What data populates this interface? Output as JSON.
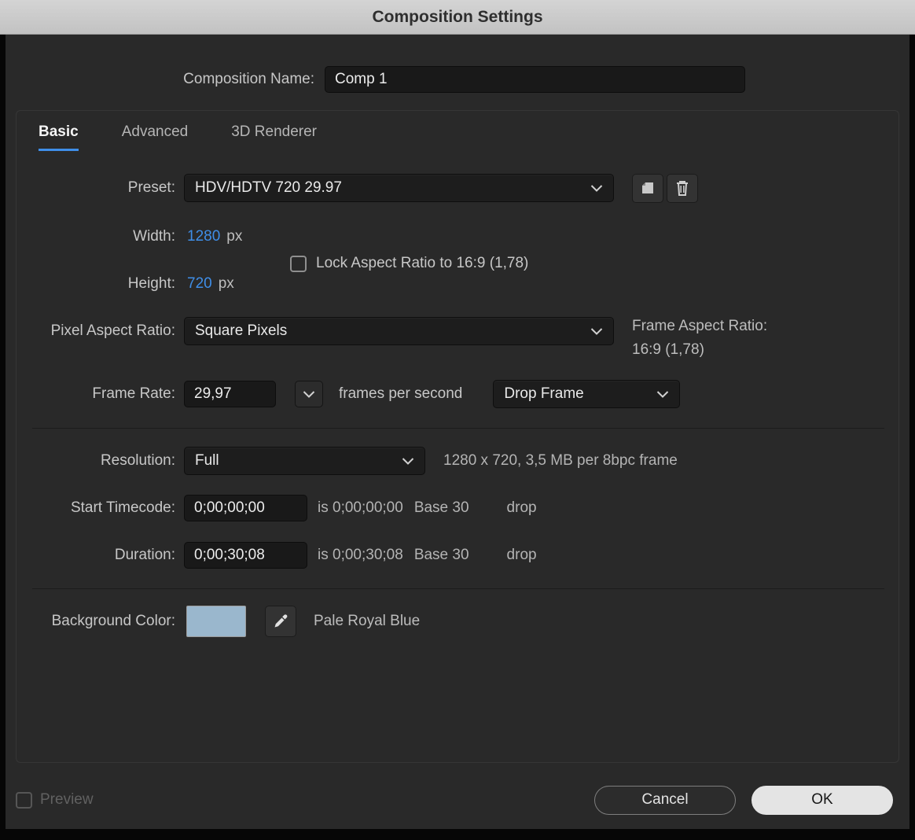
{
  "window": {
    "title": "Composition Settings"
  },
  "composition_name": {
    "label": "Composition Name:",
    "value": "Comp 1"
  },
  "tabs": {
    "basic": "Basic",
    "advanced": "Advanced",
    "renderer_3d": "3D Renderer"
  },
  "basic_tab": {
    "preset": {
      "label": "Preset:",
      "value": "HDV/HDTV 720 29.97"
    },
    "width": {
      "label": "Width:",
      "value": "1280",
      "unit": "px"
    },
    "height": {
      "label": "Height:",
      "value": "720",
      "unit": "px"
    },
    "lock_aspect": {
      "label": "Lock Aspect Ratio to 16:9 (1,78)",
      "checked": false
    },
    "pixel_aspect_ratio": {
      "label": "Pixel Aspect Ratio:",
      "value": "Square Pixels"
    },
    "frame_aspect_ratio": {
      "label": "Frame Aspect Ratio:",
      "value": "16:9 (1,78)"
    },
    "frame_rate": {
      "label": "Frame Rate:",
      "value": "29,97",
      "unit_text": "frames per second",
      "drop_mode": "Drop Frame"
    },
    "resolution": {
      "label": "Resolution:",
      "value": "Full",
      "info": "1280 x 720, 3,5 MB per 8bpc frame"
    },
    "start_timecode": {
      "label": "Start Timecode:",
      "value": "0;00;00;00",
      "info": "is 0;00;00;00",
      "base": "Base 30",
      "drop": "drop"
    },
    "duration": {
      "label": "Duration:",
      "value": "0;00;30;08",
      "info": "is 0;00;30;08",
      "base": "Base 30",
      "drop": "drop"
    },
    "background_color": {
      "label": "Background Color:",
      "name": "Pale Royal Blue",
      "swatch": "#9ab7cd"
    }
  },
  "footer": {
    "preview": "Preview",
    "cancel": "Cancel",
    "ok": "OK"
  },
  "icons": {
    "preset_save": "folded-page",
    "preset_delete": "trash-can",
    "dropdown": "chevron-down",
    "eyedropper": "eyedropper",
    "checkbox": "empty-square"
  },
  "colors": {
    "accent_blue": "#3f8ee8",
    "tab_underline": "#3f8ee8",
    "swatch": "#9ab7cd"
  }
}
